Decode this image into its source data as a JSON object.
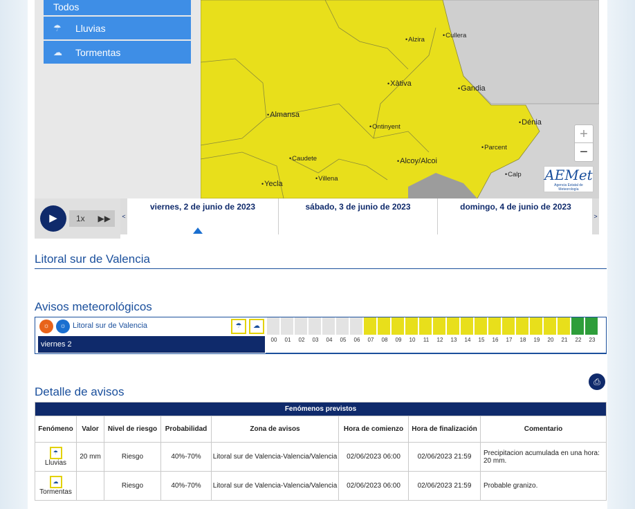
{
  "colors": {
    "yellow": "#e8df1b",
    "green": "#2e9e3a",
    "navy": "#0f2a6b",
    "blue": "#1a4f9c",
    "menu": "#3e8ee6"
  },
  "phenomena_menu": [
    {
      "label": "Todos",
      "icon": "all-icon"
    },
    {
      "label": "Lluvias",
      "icon": "rain-icon"
    },
    {
      "label": "Tormentas",
      "icon": "storm-icon"
    }
  ],
  "map": {
    "cities": [
      "Alzira",
      "Cullera",
      "Xàtiva",
      "Gandia",
      "Almansa",
      "Ontinyent",
      "Dénia",
      "Parcent",
      "Caudete",
      "Alcoy/Alcoi",
      "Villena",
      "Calp",
      "Yecla"
    ],
    "zoom_in": "+",
    "zoom_out": "−",
    "logo_text": "AEMet",
    "logo_sub": "Agencia Estatal de Meteorología"
  },
  "player": {
    "speed": "1x",
    "play_icon": "▶",
    "ff_icon": "▶▶"
  },
  "days": [
    "viernes, 2 de junio de 2023",
    "sábado, 3 de junio de 2023",
    "domingo, 4 de junio de 2023"
  ],
  "nav": {
    "prev": "<",
    "next": ">"
  },
  "zone_title": "Litoral sur de Valencia",
  "avisos_title": "Avisos meteorológicos",
  "timeline": {
    "zone": "Litoral sur de Valencia",
    "day": "viernes 2",
    "hours": [
      "00",
      "01",
      "02",
      "03",
      "04",
      "05",
      "06",
      "07",
      "08",
      "09",
      "10",
      "11",
      "12",
      "13",
      "14",
      "15",
      "16",
      "17",
      "18",
      "19",
      "20",
      "21",
      "22",
      "23"
    ],
    "levels": [
      "none",
      "none",
      "none",
      "none",
      "none",
      "none",
      "none",
      "yellow",
      "yellow",
      "yellow",
      "yellow",
      "yellow",
      "yellow",
      "yellow",
      "yellow",
      "yellow",
      "yellow",
      "yellow",
      "yellow",
      "yellow",
      "yellow",
      "yellow",
      "green",
      "green"
    ]
  },
  "detalle_title": "Detalle de avisos",
  "table": {
    "caption": "Fenómenos previstos",
    "headers": [
      "Fenómeno",
      "Valor",
      "Nivel de riesgo",
      "Probabilidad",
      "Zona de avisos",
      "Hora de comienzo",
      "Hora de finalización",
      "Comentario"
    ],
    "rows": [
      {
        "phenomenon": "Lluvias",
        "value": "20 mm",
        "level": "Riesgo",
        "probability": "40%-70%",
        "zone": "Litoral sur de Valencia-Valencia/Valencia",
        "start": "02/06/2023 06:00",
        "end": "02/06/2023 21:59",
        "comment": "Precipitacion acumulada en una hora: 20 mm."
      },
      {
        "phenomenon": "Tormentas",
        "value": "",
        "level": "Riesgo",
        "probability": "40%-70%",
        "zone": "Litoral sur de Valencia-Valencia/Valencia",
        "start": "02/06/2023 06:00",
        "end": "02/06/2023 21:59",
        "comment": "Probable granizo."
      }
    ]
  }
}
